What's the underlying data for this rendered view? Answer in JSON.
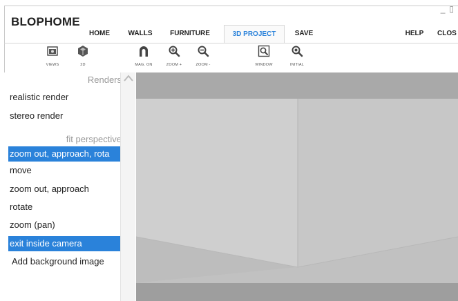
{
  "app": {
    "title": "BLOPHOME",
    "window_controls": [
      "_",
      "▯"
    ]
  },
  "menu": {
    "items": [
      {
        "id": "home",
        "label": "HOME"
      },
      {
        "id": "walls",
        "label": "WALLS"
      },
      {
        "id": "furniture",
        "label": "FURNITURE"
      },
      {
        "id": "project3d",
        "label": "3D PROJECT",
        "active": true
      },
      {
        "id": "save",
        "label": "SAVE"
      },
      {
        "id": "help",
        "label": "HELP"
      },
      {
        "id": "close",
        "label": "CLOS"
      }
    ]
  },
  "toolbar": {
    "views": "VIEWS",
    "two_d": "2D",
    "mag_on": "MAG. ON",
    "zoom_in": "ZOOM +",
    "zoom_out": "ZOOM -",
    "window": "WINDOW",
    "initial": "INITIAL"
  },
  "side_list": {
    "renders_header": "Renders",
    "realistic_render": "realistic render",
    "stereo_render": "stereo render",
    "fit_header": "fit perspective",
    "zoom_approach_rotate": "zoom out, approach, rota",
    "move": "move",
    "zoom_approach": "zoom out, approach",
    "rotate": "rotate",
    "zoom_pan": "zoom (pan)",
    "exit_camera": "exit inside camera",
    "add_background": "Add background image"
  },
  "colors": {
    "accent": "#2a82da",
    "viewport_wall_left": "#cfcfcf",
    "viewport_wall_back": "#c6c6c6",
    "viewport_top": "#a9a9a9",
    "viewport_floor": "#bdbdbd",
    "viewport_bottom": "#9e9e9e"
  }
}
